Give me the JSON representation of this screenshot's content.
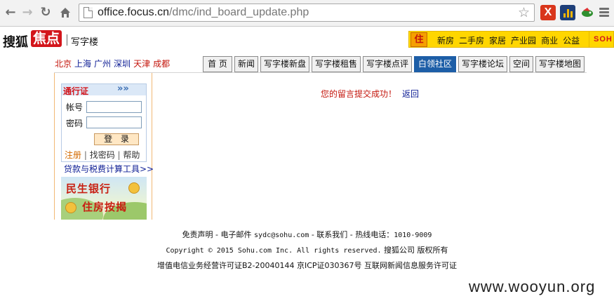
{
  "browser": {
    "url_host": "office.focus.cn",
    "url_path": "/dmc/ind_board_update.php"
  },
  "header": {
    "logo_sohu": "搜狐",
    "logo_focus": "焦点",
    "logo_section": "写字楼",
    "topnav": [
      "新房",
      "二手房",
      "家居",
      "产业园",
      "商业",
      "公益"
    ],
    "home_glyph": "住",
    "badge": "SOH"
  },
  "cities": [
    {
      "label": "北京",
      "color": "#c4160c"
    },
    {
      "label": "上海",
      "color": "#0c1c94"
    },
    {
      "label": "广州",
      "color": "#0c1c94"
    },
    {
      "label": "深圳",
      "color": "#0c1c94"
    },
    {
      "label": "天津",
      "color": "#c4160c"
    },
    {
      "label": "成都",
      "color": "#c4160c"
    }
  ],
  "tabs": [
    {
      "label": "首 页"
    },
    {
      "label": "新闻"
    },
    {
      "label": "写字楼新盘"
    },
    {
      "label": "写字楼租售"
    },
    {
      "label": "写字楼点评"
    },
    {
      "label": "白领社区",
      "active": true
    },
    {
      "label": "写字楼论坛"
    },
    {
      "label": "空间"
    },
    {
      "label": "写字楼地图"
    }
  ],
  "sidebar": {
    "pass_title": "通行证",
    "arrows": "»»",
    "account_label": "帐号",
    "password_label": "密码",
    "login_label": "登 录",
    "register": "注册",
    "find_password": "找密码",
    "help": "帮助",
    "calc_link": "贷款与税费计算工具>>",
    "banner_line1": "民生银行",
    "banner_line2": "住房按揭"
  },
  "message": {
    "success": "您的留言提交成功！",
    "back": "返回"
  },
  "footer": {
    "line1_a": "免责声明 - 电子邮件",
    "line1_email": "sydc@sohu.com",
    "line1_b": "- 联系我们 - 热线电话：",
    "line1_phone": "1010-9009",
    "line2_a": "Copyright © 2015 Sohu.com Inc. All rights reserved.",
    "line2_b": "搜狐公司 版权所有",
    "line3": "增值电信业务经营许可证B2-20040144 京ICP证030367号  互联网新闻信息服务许可证"
  },
  "watermark": "www.wooyun.org"
}
